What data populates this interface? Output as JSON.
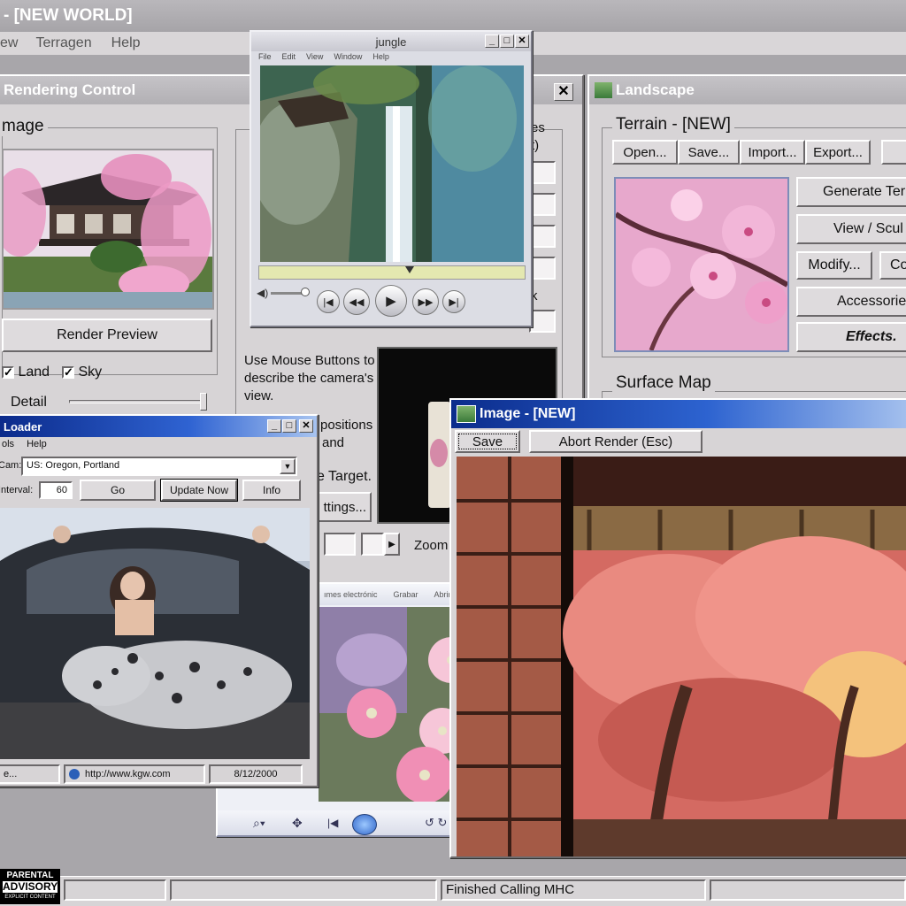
{
  "main_title": "- [NEW WORLD]",
  "menu": [
    "ew",
    "Terragen",
    "Help"
  ],
  "rendering": {
    "title": "Rendering Control",
    "image_group": "mage",
    "render_preview": "Render Preview",
    "land": "Land",
    "sky": "Sky",
    "detail": "Detail",
    "camera_instructions": "Use Mouse Buttons to describe the camera's view.",
    "positions_fragment": "positions",
    "and_fragment": "and",
    "target_fragment": "e Target.",
    "settings_button": "ttings...",
    "zoom": "Zoom",
    "partial_es": "es",
    "partial_t": "t)",
    "partial_k": "k"
  },
  "jungle": {
    "title": "jungle",
    "menu": [
      "File",
      "Edit",
      "View",
      "Window",
      "Help"
    ]
  },
  "landscape": {
    "title": "Landscape",
    "terrain_label": "Terrain - [NEW]",
    "buttons": [
      "Open...",
      "Save...",
      "Import...",
      "Export..."
    ],
    "side_buttons": [
      "Generate Ter",
      "View / Scul",
      "Accessorie",
      "Effects."
    ],
    "modify": "Modify...",
    "co": "Co",
    "surface_map": "Surface Map"
  },
  "loader": {
    "title": "Loader",
    "menu": [
      "ols",
      "Help"
    ],
    "cam_label": "Cam:",
    "cam_value": "US: Oregon, Portland",
    "interval_label": "Interval:",
    "interval_value": "60",
    "go": "Go",
    "update_now": "Update Now",
    "info": "Info",
    "status_left": "e...",
    "status_url": "http://www.kgw.com",
    "status_date": "8/12/2000"
  },
  "viewer": {
    "toolbar": [
      "ımes electrónic",
      "Grabar",
      "Abrir"
    ]
  },
  "image_window": {
    "title": "Image - [NEW]",
    "save": "Save",
    "abort": "Abort Render (Esc)"
  },
  "statusbar": {
    "text": "Finished Calling MHC"
  },
  "advisory": {
    "line1": "PARENTAL",
    "line2": "ADVISORY",
    "line3": "EXPLICIT CONTENT"
  }
}
